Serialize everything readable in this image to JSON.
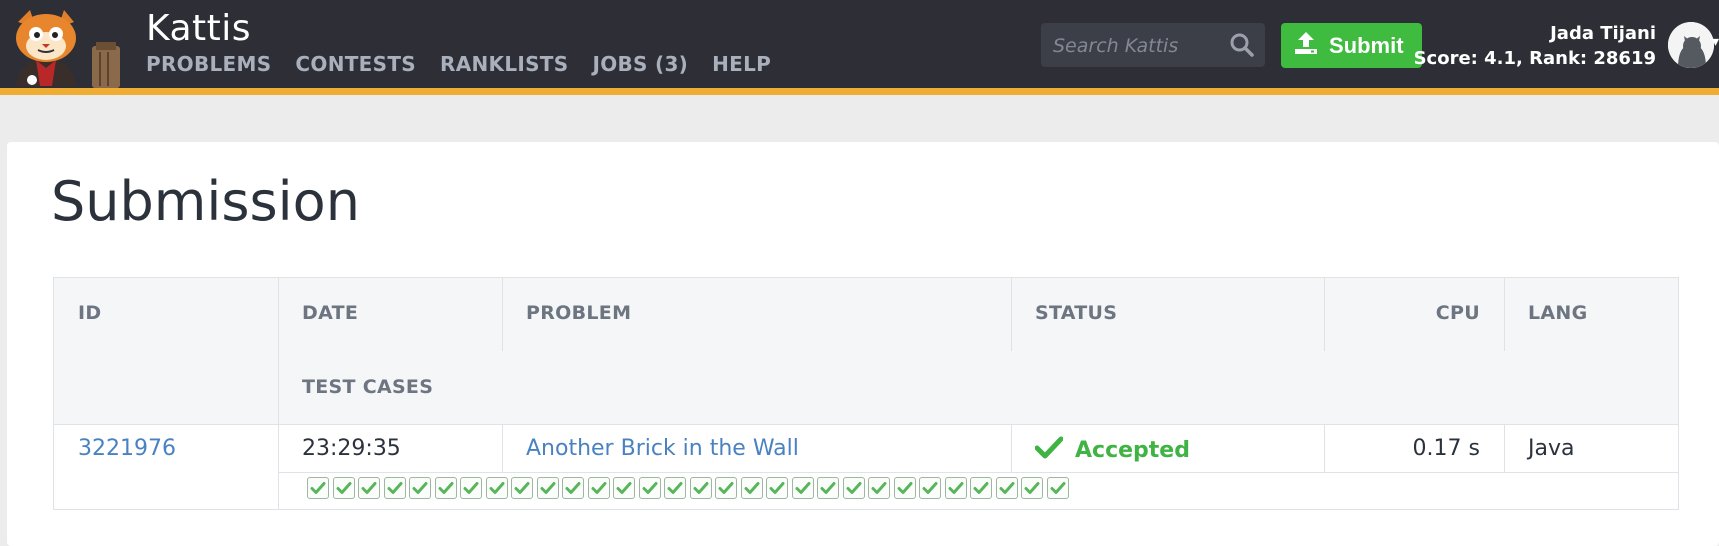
{
  "brand": "Kattis",
  "nav": [
    {
      "label": "PROBLEMS"
    },
    {
      "label": "CONTESTS"
    },
    {
      "label": "RANKLISTS"
    },
    {
      "label": "JOBS (3)"
    },
    {
      "label": "HELP"
    }
  ],
  "search": {
    "placeholder": "Search Kattis",
    "value": ""
  },
  "submit_label": "Submit",
  "user": {
    "name": "Jada Tijani",
    "score_rank": "Score: 4.1, Rank: 28619"
  },
  "page_title": "Submission",
  "table": {
    "headers": {
      "id": "ID",
      "date": "DATE",
      "problem": "PROBLEM",
      "status": "STATUS",
      "cpu": "CPU",
      "lang": "LANG",
      "test_cases": "TEST CASES"
    },
    "row": {
      "id": "3221976",
      "date": "23:29:35",
      "problem": "Another Brick in the Wall",
      "status": "Accepted",
      "cpu": "0.17 s",
      "lang": "Java",
      "test_cases_passed": 30,
      "test_cases_total": 30
    }
  },
  "colors": {
    "accent": "#f0ad33",
    "header_bg": "#2d2e36",
    "accepted": "#3fb344",
    "link": "#4a82c1",
    "submit": "#3fbb3f"
  },
  "icons": {
    "search": "search-icon",
    "upload": "upload-icon",
    "check": "check-icon",
    "avatar": "cat-silhouette-icon"
  }
}
